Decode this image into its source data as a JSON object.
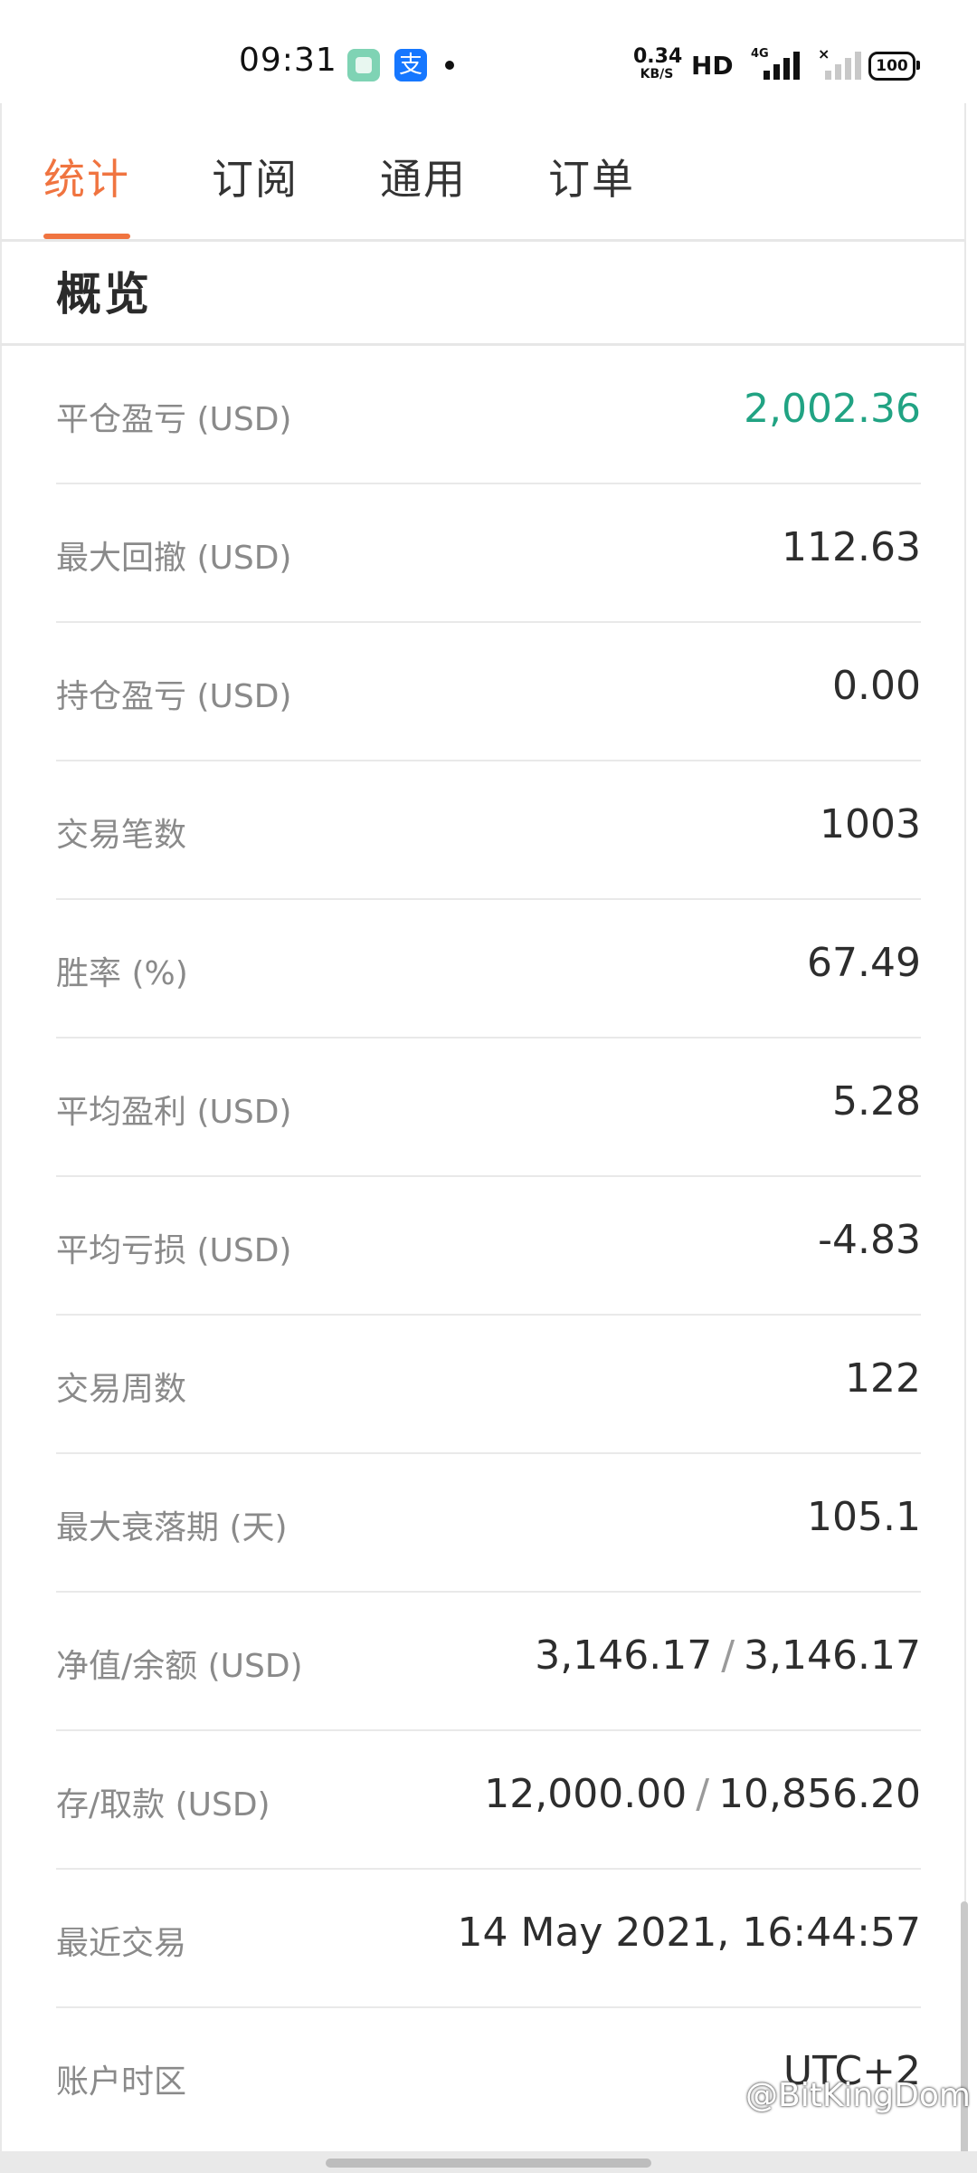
{
  "status_bar": {
    "time": "09:31",
    "app1_icon": "chat-app-icon",
    "app2_icon": "alipay-icon",
    "app2_glyph": "支",
    "net_speed_value": "0.34",
    "net_speed_unit": "KB/S",
    "hd_label": "HD",
    "network_type": "4G",
    "sim2_glyph": "×",
    "battery": "100"
  },
  "tabs": [
    {
      "label": "统计",
      "active": true
    },
    {
      "label": "订阅",
      "active": false
    },
    {
      "label": "通用",
      "active": false
    },
    {
      "label": "订单",
      "active": false
    }
  ],
  "accent_color": "#f07440",
  "positive_color": "#21a383",
  "section": {
    "title": "概览"
  },
  "stats": [
    {
      "label": "平仓盈亏 (USD)",
      "value": "2,002.36"
    },
    {
      "label": "最大回撤 (USD)",
      "value": "112.63"
    },
    {
      "label": "持仓盈亏 (USD)",
      "value": "0.00"
    },
    {
      "label": "交易笔数",
      "value": "1003"
    },
    {
      "label": "胜率 (%)",
      "value": "67.49"
    },
    {
      "label": "平均盈利 (USD)",
      "value": "5.28"
    },
    {
      "label": "平均亏损 (USD)",
      "value": "-4.83"
    },
    {
      "label": "交易周数",
      "value": "122"
    },
    {
      "label": "最大衰落期 (天)",
      "value": "105.1"
    },
    {
      "label": "净值/余额 (USD)",
      "value_a": "3,146.17",
      "separator": "/",
      "value_b": "3,146.17"
    },
    {
      "label": "存/取款 (USD)",
      "value_a": "12,000.00",
      "separator": "/",
      "value_b": "10,856.20"
    },
    {
      "label": "最近交易",
      "value": "14 May 2021, 16:44:57"
    },
    {
      "label": "账户时区",
      "value": "UTC+2"
    }
  ],
  "watermark": {
    "icon": "weibo-icon",
    "text": "@BitKingDom"
  }
}
